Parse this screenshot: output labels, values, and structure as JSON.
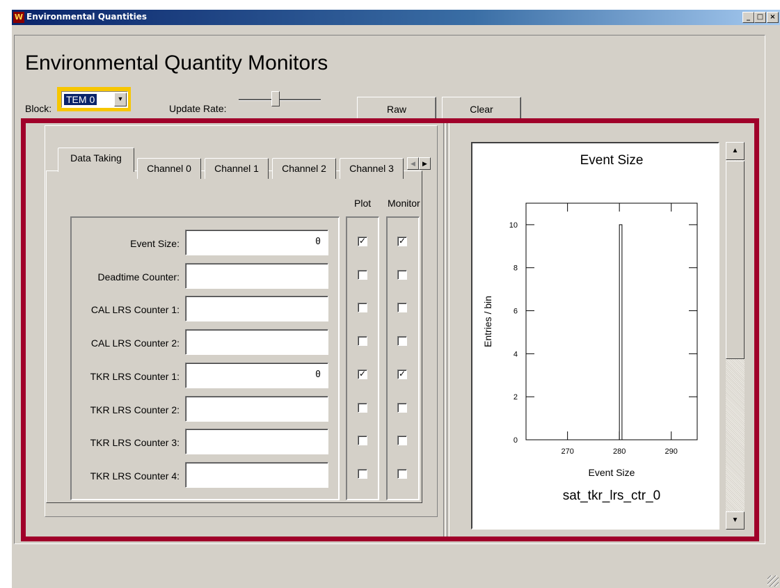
{
  "window": {
    "title": "Environmental Quantities",
    "controls": {
      "minimize": "_",
      "maximize": "□",
      "close": "×"
    }
  },
  "header": {
    "title": "Environmental Quantity Monitors",
    "block_label": "Block:",
    "block_value": "TEM 0",
    "update_rate_label": "Update Rate:",
    "update_rate_level": 0.45,
    "raw_label": "Raw",
    "clear_label": "Clear"
  },
  "tabs": [
    {
      "label": "Data Taking",
      "active": true
    },
    {
      "label": "Channel 0"
    },
    {
      "label": "Channel 1"
    },
    {
      "label": "Channel 2"
    },
    {
      "label": "Channel 3"
    }
  ],
  "columns": {
    "plot": "Plot",
    "monitor": "Monitor"
  },
  "rows": [
    {
      "label": "Event Size:",
      "value": "0",
      "plot": true,
      "monitor": true
    },
    {
      "label": "Deadtime Counter:",
      "value": "",
      "plot": false,
      "monitor": false
    },
    {
      "label": "CAL  LRS Counter 1:",
      "value": "",
      "plot": false,
      "monitor": false
    },
    {
      "label": "CAL LRS Counter 2:",
      "value": "",
      "plot": false,
      "monitor": false
    },
    {
      "label": "TKR LRS Counter 1:",
      "value": "0",
      "plot": true,
      "monitor": true
    },
    {
      "label": "TKR LRS Counter 2:",
      "value": "",
      "plot": false,
      "monitor": false
    },
    {
      "label": "TKR LRS Counter 3:",
      "value": "",
      "plot": false,
      "monitor": false
    },
    {
      "label": "TKR LRS Counter 4:",
      "value": "",
      "plot": false,
      "monitor": false
    }
  ],
  "chart_data": {
    "type": "bar",
    "title": "Event Size",
    "subtitle": "sat_tkr_lrs_ctr_0",
    "xlabel": "Event Size",
    "ylabel": "Entries / bin",
    "xlim": [
      262,
      295
    ],
    "ylim": [
      0,
      11
    ],
    "xticks": [
      270,
      280,
      290
    ],
    "yticks": [
      0,
      2,
      4,
      6,
      8,
      10
    ],
    "bins": [
      {
        "x0": 280,
        "x1": 280.5,
        "value": 10
      }
    ],
    "grid": false
  },
  "icons": {
    "dropdown": "chevron-down-icon",
    "scroll_up": "arrow-up-icon",
    "scroll_down": "arrow-down-icon",
    "tab_left": "arrow-left-icon",
    "tab_right": "arrow-right-icon"
  },
  "colors": {
    "highlight": "#f7c600",
    "accent_frame": "#a0002a",
    "titlebar": "#0a246a"
  }
}
